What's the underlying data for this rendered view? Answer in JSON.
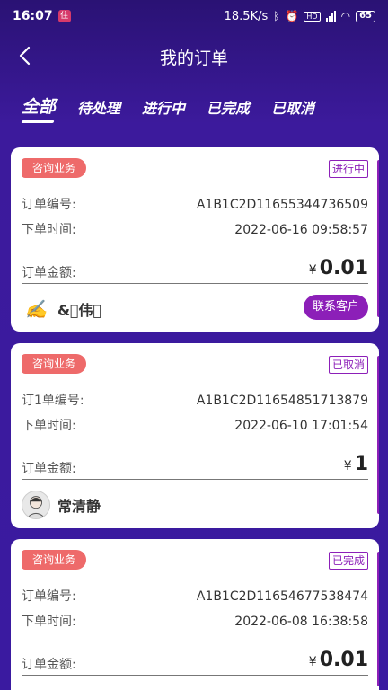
{
  "statusbar": {
    "time": "16:07",
    "app_badge": "住",
    "speed": "18.5K/s",
    "network": "4G",
    "battery": "65"
  },
  "header": {
    "title": "我的订单"
  },
  "tabs": [
    {
      "label": "全部",
      "active": true
    },
    {
      "label": "待处理",
      "active": false
    },
    {
      "label": "进行中",
      "active": false
    },
    {
      "label": "已完成",
      "active": false
    },
    {
      "label": "已取消",
      "active": false
    }
  ],
  "orders": [
    {
      "tag": "咨询业务",
      "status": "进行中",
      "order_no_label": "订单编号:",
      "order_no": "A1B1C2D11655344736509",
      "time_label": "下单时间:",
      "time": "2022-06-16 09:58:57",
      "amount_label": "订单金额:",
      "currency": "¥",
      "amount": "0.01",
      "customer_name": "&\u0000伟\u0000",
      "contact_label": "联系客户"
    },
    {
      "tag": "咨询业务",
      "status": "已取消",
      "order_no_label": "订1单编号:",
      "order_no": "A1B1C2D11654851713879",
      "time_label": "下单时间:",
      "time": "2022-06-10 17:01:54",
      "amount_label": "订单金额:",
      "currency": "¥",
      "amount": "1",
      "customer_name": "常清静"
    },
    {
      "tag": "咨询业务",
      "status": "已完成",
      "order_no_label": "订单编号:",
      "order_no": "A1B1C2D11654677538474",
      "time_label": "下单时间:",
      "time": "2022-06-08 16:38:58",
      "amount_label": "订单金额:",
      "currency": "¥",
      "amount": "0.01"
    }
  ]
}
